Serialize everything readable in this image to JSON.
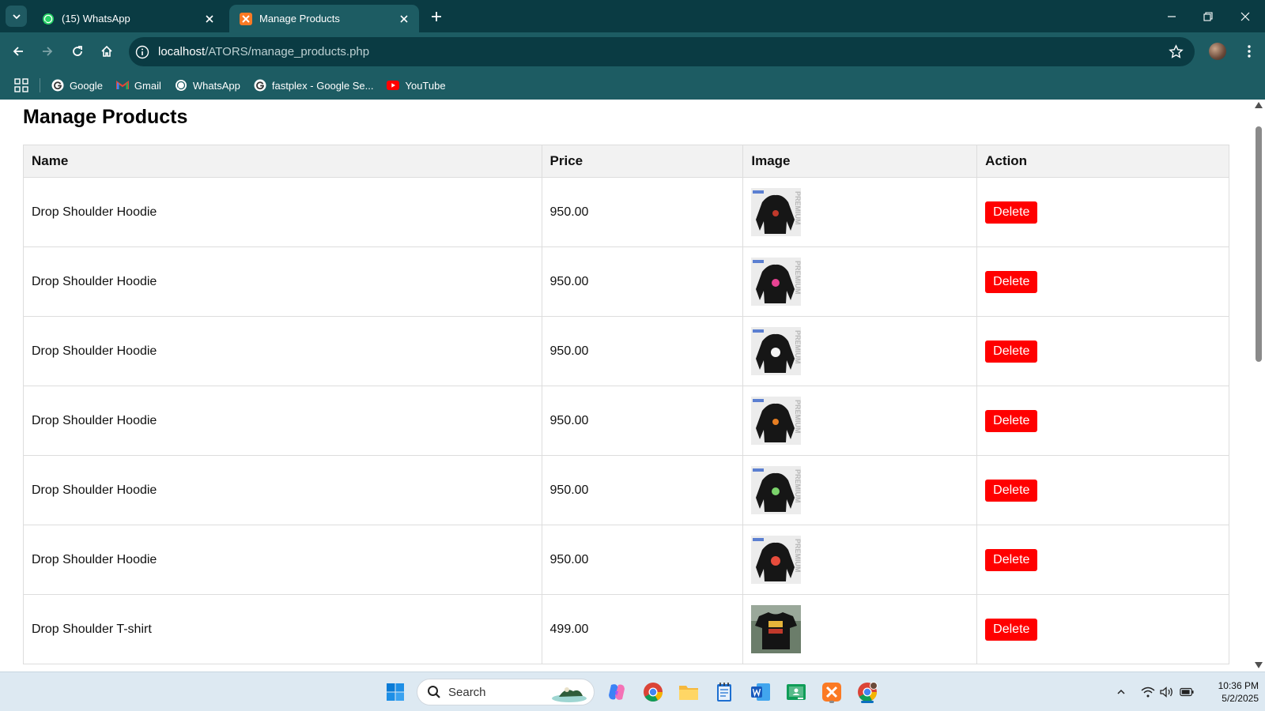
{
  "browser": {
    "tabs": [
      {
        "title": "(15) WhatsApp",
        "active": false
      },
      {
        "title": "Manage Products",
        "active": true
      }
    ],
    "url_host": "localhost",
    "url_path": "/ATORS/manage_products.php",
    "bookmarks": [
      {
        "label": "Google",
        "icon": "google-icon"
      },
      {
        "label": "Gmail",
        "icon": "gmail-icon"
      },
      {
        "label": "WhatsApp",
        "icon": "whatsapp-icon"
      },
      {
        "label": "fastplex - Google Se...",
        "icon": "google-icon"
      },
      {
        "label": "YouTube",
        "icon": "youtube-icon"
      }
    ]
  },
  "page": {
    "title": "Manage Products",
    "columns": [
      "Name",
      "Price",
      "Image",
      "Action"
    ],
    "products": [
      {
        "name": "Drop Shoulder Hoodie",
        "price": "950.00",
        "image": "hoodie-thumbnail",
        "action": "Delete"
      },
      {
        "name": "Drop Shoulder Hoodie",
        "price": "950.00",
        "image": "hoodie-thumbnail",
        "action": "Delete"
      },
      {
        "name": "Drop Shoulder Hoodie",
        "price": "950.00",
        "image": "hoodie-thumbnail",
        "action": "Delete"
      },
      {
        "name": "Drop Shoulder Hoodie",
        "price": "950.00",
        "image": "hoodie-thumbnail",
        "action": "Delete"
      },
      {
        "name": "Drop Shoulder Hoodie",
        "price": "950.00",
        "image": "hoodie-thumbnail",
        "action": "Delete"
      },
      {
        "name": "Drop Shoulder Hoodie",
        "price": "950.00",
        "image": "hoodie-thumbnail",
        "action": "Delete"
      },
      {
        "name": "Drop Shoulder T-shirt",
        "price": "499.00",
        "image": "tshirt-thumbnail",
        "action": "Delete"
      }
    ]
  },
  "taskbar": {
    "search_placeholder": "Search",
    "time": "10:36 PM",
    "date": "5/2/2025"
  },
  "colors": {
    "tab_strip": "#0a3b43",
    "toolbar": "#1d5c63",
    "delete_button": "#ff0000",
    "table_header": "#f2f2f2",
    "taskbar": "#dde9f2"
  }
}
